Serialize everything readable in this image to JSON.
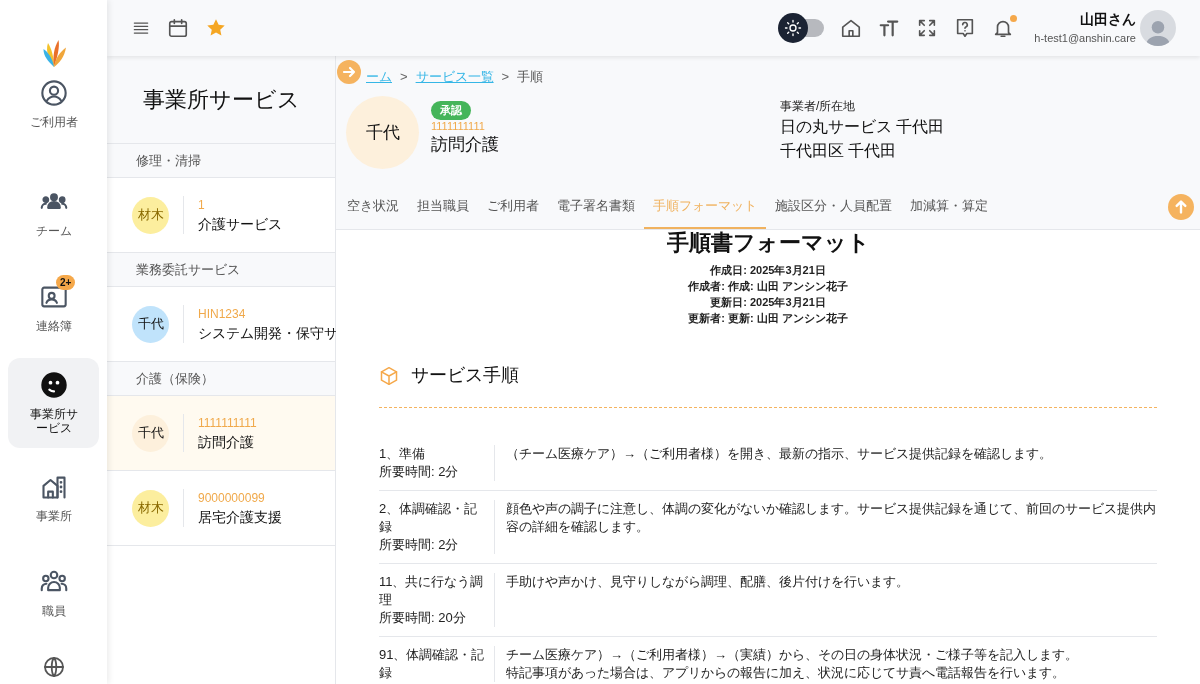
{
  "sidebar": {
    "items": [
      {
        "label": "ご利用者",
        "selected": false
      },
      {
        "label": "チーム",
        "selected": false
      },
      {
        "label": "連絡簿",
        "selected": false,
        "badge": "2+"
      },
      {
        "label": "事業所サービス",
        "selected": true
      },
      {
        "label": "事業所",
        "selected": false
      },
      {
        "label": "職員",
        "selected": false
      }
    ]
  },
  "topbar": {
    "user_name": "山田さん",
    "user_email": "h-test1@anshin.care",
    "dark_mode": false,
    "notification_dot": true
  },
  "service_panel": {
    "title": "事業所サービス",
    "groups": [
      {
        "heading": "修理・清掃",
        "items": [
          {
            "avatar": "材木",
            "color": "#fcee9e",
            "code": "1",
            "name": "介護サービス",
            "selected": false
          }
        ]
      },
      {
        "heading": "業務委託サービス",
        "items": [
          {
            "avatar": "千代",
            "color": "#c0e3fb",
            "code": "HIN1234",
            "name": "システム開発・保守サ",
            "selected": false
          }
        ]
      },
      {
        "heading": "介護（保険）",
        "items": [
          {
            "avatar": "千代",
            "color": "#fdf0dc",
            "code": "1111111111",
            "name": "訪問介護",
            "selected": true
          },
          {
            "avatar": "材木",
            "color": "#fcee9e",
            "code": "9000000099",
            "name": "居宅介護支援",
            "selected": false
          }
        ]
      }
    ]
  },
  "breadcrumb": [
    {
      "kind": "link",
      "text": "ーム"
    },
    {
      "kind": "separator",
      "text": ">"
    },
    {
      "kind": "link",
      "text": "サービス一覧"
    },
    {
      "kind": "separator",
      "text": ">"
    },
    {
      "kind": "current",
      "text": "手順"
    }
  ],
  "header": {
    "avatar": "千代",
    "badge": "承認",
    "code": "1111111111",
    "name": "訪問介護",
    "owner_label": "事業者/所在地",
    "owner_lines": [
      "日の丸サービス 千代田",
      "千代田区 千代田"
    ]
  },
  "tabs": [
    {
      "label": "空き状況",
      "selected": false
    },
    {
      "label": "担当職員",
      "selected": false
    },
    {
      "label": "ご利用者",
      "selected": false
    },
    {
      "label": "電子署名書類",
      "selected": false
    },
    {
      "label": "手順フォーマット",
      "selected": true
    },
    {
      "label": "施設区分・人員配置",
      "selected": false
    },
    {
      "label": "加減算・算定",
      "selected": false
    }
  ],
  "document": {
    "title": "手順書フォーマット",
    "meta": [
      "作成日: 2025年3月21日",
      "作成者: 作成: 山田 アンシン花子",
      "更新日: 2025年3月21日",
      "更新者: 更新: 山田 アンシン花子"
    ],
    "section_title": "サービス手順",
    "steps": [
      {
        "title": "1、準備",
        "time": "所要時間: 2分",
        "description": "（チーム医療ケア）→（ご利用者様）を開き、最新の指示、サービス提供記録を確認します。"
      },
      {
        "title": "2、体調確認・記録",
        "time": "所要時間: 2分",
        "description": "顔色や声の調子に注意し、体調の変化がないか確認します。サービス提供記録を通じて、前回のサービス提供内容の詳細を確認します。"
      },
      {
        "title": "11、共に行なう調理",
        "time": "所要時間: 20分",
        "description": "手助けや声かけ、見守りしながら調理、配膳、後片付けを行います。"
      },
      {
        "title": "91、体調確認・記録",
        "description": "チーム医療ケア）→（ご利用者様）→（実績）から、その日の身体状況・ご様子等を記入します。",
        "note": "特記事項があった場合は、アプリからの報告に加え、状況に応じてサ責へ電話報告を行います。"
      }
    ]
  }
}
